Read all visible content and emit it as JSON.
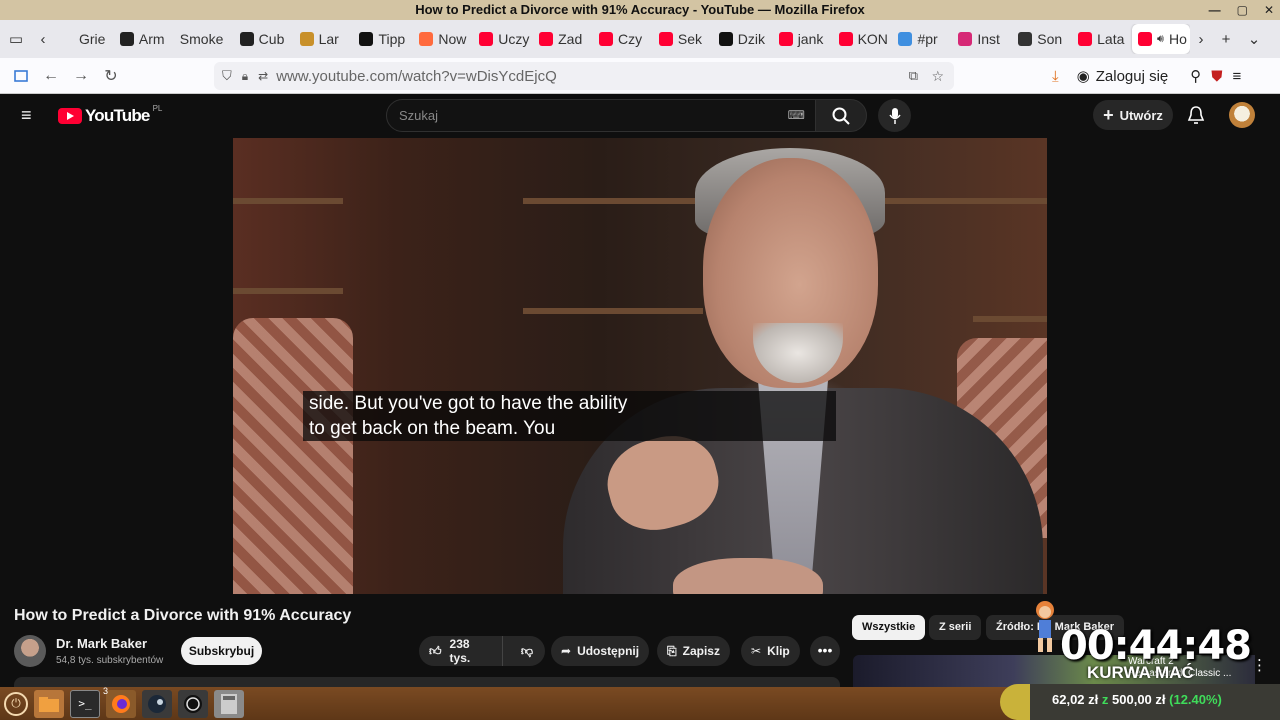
{
  "window": {
    "title": "How to Predict a Divorce with 91% Accuracy - YouTube — Mozilla Firefox"
  },
  "tabs": [
    {
      "label": "Grie",
      "color": "#e8e8ed",
      "icon": "generic-icon"
    },
    {
      "label": "Arm",
      "color": "#222222",
      "icon": "circle-logo-icon"
    },
    {
      "label": "Smoke",
      "color": "#e8e8ed",
      "icon": "none"
    },
    {
      "label": "Cub",
      "color": "#222222",
      "icon": "circle-logo-icon"
    },
    {
      "label": "Lar",
      "color": "#c8902a",
      "icon": "shield-logo-icon"
    },
    {
      "label": "Tipp",
      "color": "#111111",
      "icon": "tip-logo-icon"
    },
    {
      "label": "Now",
      "color": "#ff6a3d",
      "icon": "donut-icon"
    },
    {
      "label": "Uczy",
      "color": "#ff0033",
      "icon": "youtube-icon"
    },
    {
      "label": "Zad",
      "color": "#ff0033",
      "icon": "youtube-icon"
    },
    {
      "label": "Czy",
      "color": "#ff0033",
      "icon": "youtube-icon"
    },
    {
      "label": "Sek",
      "color": "#ff0033",
      "icon": "youtube-icon"
    },
    {
      "label": "Dzik",
      "color": "#111111",
      "icon": "x-logo-icon"
    },
    {
      "label": "jank",
      "color": "#ff0033",
      "icon": "youtube-icon"
    },
    {
      "label": "KON",
      "color": "#ff0033",
      "icon": "youtube-icon"
    },
    {
      "label": "#pr",
      "color": "#3f8fe0",
      "icon": "app-icon"
    },
    {
      "label": "Inst",
      "color": "#d62976",
      "icon": "instagram-icon"
    },
    {
      "label": "Son",
      "color": "#333333",
      "icon": "image-icon"
    },
    {
      "label": "Lata",
      "color": "#ff0033",
      "icon": "youtube-icon"
    },
    {
      "label": "Ho",
      "color": "#ff0033",
      "icon": "youtube-icon",
      "active": true
    }
  ],
  "navbar": {
    "url": "www.youtube.com/watch?v=wDisYcdEjcQ",
    "login_label": "Zaloguj się"
  },
  "youtube": {
    "logo_text": "YouTube",
    "region": "PL",
    "search_placeholder": "Szukaj",
    "create_label": "Utwórz"
  },
  "video": {
    "caption_line1": "side. But you've got to have the ability",
    "caption_line2": "to get back on the beam. You",
    "title": "How to Predict a Divorce with 91% Accuracy",
    "channel_name": "Dr. Mark Baker",
    "subscribers": "54,8 tys. subskrybentów",
    "subscribe_label": "Subskrybuj",
    "likes": "238 tys.",
    "share_label": "Udostępnij",
    "save_label": "Zapisz",
    "clip_label": "Klip"
  },
  "chips": [
    {
      "label": "Wszystkie",
      "active": true
    },
    {
      "label": "Z serii",
      "active": false
    },
    {
      "label": "Źródło: Dr. Mark Baker",
      "active": false
    }
  ],
  "recommended": {
    "line1": "Warcraft 2",
    "line2": "Remastered: Classic ..."
  },
  "overlay": {
    "timer": "00:44:48",
    "caption": "KURWA MAĆ"
  },
  "donation": {
    "current": "62,02 zł",
    "sep": "z",
    "goal": "500,00 zł",
    "percent": "(12.40%)",
    "progress": 0.124
  },
  "taskbar": {
    "firefox_badge": "3"
  },
  "colors": {
    "yt_red": "#ff0033",
    "bg": "#0f0f0f",
    "taskbar": "#6a3f1b"
  }
}
